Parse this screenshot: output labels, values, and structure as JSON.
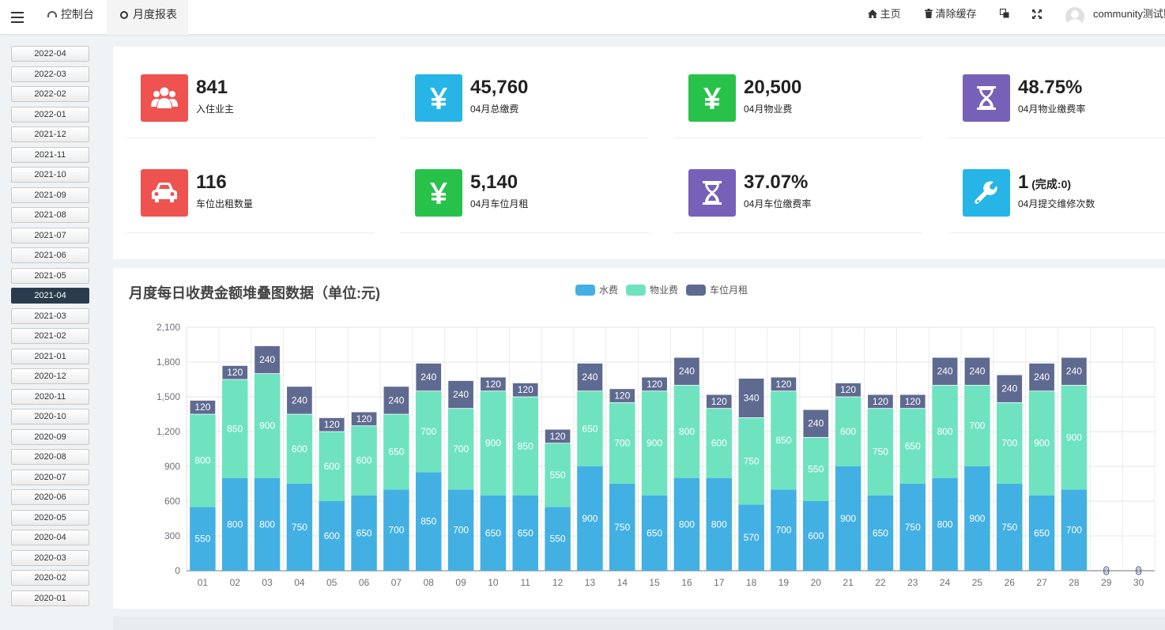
{
  "topbar": {
    "tabs": [
      {
        "label": "控制台"
      },
      {
        "label": "月度报表"
      }
    ],
    "home_label": "主页",
    "clear_cache_label": "清除缓存",
    "username": "community测试账号"
  },
  "months": [
    "2022-04",
    "2022-03",
    "2022-02",
    "2022-01",
    "2021-12",
    "2021-11",
    "2021-10",
    "2021-09",
    "2021-08",
    "2021-07",
    "2021-06",
    "2021-05",
    "2021-04",
    "2021-03",
    "2021-02",
    "2021-01",
    "2020-12",
    "2020-11",
    "2020-10",
    "2020-09",
    "2020-08",
    "2020-07",
    "2020-06",
    "2020-05",
    "2020-04",
    "2020-03",
    "2020-02",
    "2020-01"
  ],
  "selected_month": "2021-04",
  "stats": [
    {
      "value": "841",
      "label": "入住业主",
      "color": "#ef5350",
      "icon": "users-icon"
    },
    {
      "value": "45,760",
      "label": "04月总缴费",
      "color": "#26b5e6",
      "icon": "yen-icon"
    },
    {
      "value": "20,500",
      "label": "04月物业费",
      "color": "#28c24a",
      "icon": "yen-icon"
    },
    {
      "value": "48.75%",
      "label": "04月物业缴费率",
      "color": "#7760b8",
      "icon": "hourglass-icon"
    },
    {
      "value": "116",
      "label": "车位出租数量",
      "color": "#ef5350",
      "icon": "car-icon"
    },
    {
      "value": "5,140",
      "label": "04月车位月租",
      "color": "#28c24a",
      "icon": "yen-icon"
    },
    {
      "value": "37.07%",
      "label": "04月车位缴费率",
      "color": "#7760b8",
      "icon": "hourglass-icon"
    },
    {
      "value": "1",
      "value_extra": "(完成:0)",
      "label": "04月提交维修次数",
      "color": "#26b5e6",
      "icon": "wrench-icon"
    }
  ],
  "chart_data": {
    "type": "bar",
    "stacked": true,
    "title": "月度每日收费金额堆叠图数据（单位:元)",
    "categories": [
      "01",
      "02",
      "03",
      "04",
      "05",
      "06",
      "07",
      "08",
      "09",
      "10",
      "11",
      "12",
      "13",
      "14",
      "15",
      "16",
      "17",
      "18",
      "19",
      "20",
      "21",
      "22",
      "23",
      "24",
      "25",
      "26",
      "27",
      "28",
      "29",
      "30"
    ],
    "series": [
      {
        "name": "水费",
        "color": "#42b0e3",
        "values": [
          550,
          800,
          800,
          750,
          600,
          650,
          700,
          850,
          700,
          650,
          650,
          550,
          900,
          750,
          650,
          800,
          800,
          570,
          700,
          600,
          900,
          650,
          750,
          800,
          900,
          750,
          650,
          700,
          0,
          0
        ]
      },
      {
        "name": "物业费",
        "color": "#6fe3c0",
        "values": [
          800,
          850,
          900,
          600,
          600,
          600,
          650,
          700,
          700,
          900,
          850,
          550,
          650,
          700,
          900,
          800,
          600,
          750,
          850,
          550,
          600,
          750,
          650,
          800,
          700,
          700,
          900,
          900,
          0,
          0
        ]
      },
      {
        "name": "车位月租",
        "color": "#5f6a91",
        "values": [
          120,
          120,
          240,
          240,
          120,
          120,
          240,
          240,
          240,
          120,
          120,
          120,
          240,
          120,
          120,
          240,
          120,
          340,
          120,
          240,
          120,
          120,
          120,
          240,
          240,
          240,
          240,
          240,
          0,
          0
        ]
      }
    ],
    "ylim": [
      0,
      2100
    ],
    "yticks": [
      0,
      300,
      600,
      900,
      1200,
      1500,
      1800,
      2100
    ],
    "ytick_labels": [
      "0",
      "300",
      "600",
      "900",
      "1,200",
      "1,500",
      "1,800",
      "2,100"
    ],
    "legend_position": "top-center",
    "grid": true
  }
}
